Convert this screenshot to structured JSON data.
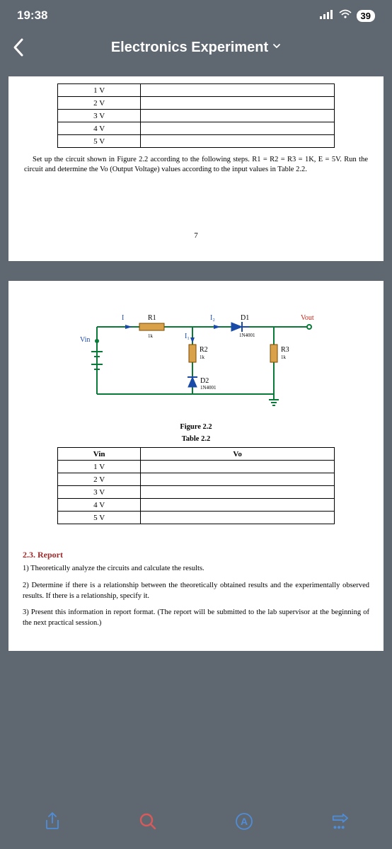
{
  "status": {
    "time": "19:38",
    "battery": "39"
  },
  "header": {
    "title": "Electronics Experiment"
  },
  "page1": {
    "table1_rows": [
      "1 V",
      "2 V",
      "3 V",
      "4 V",
      "5 V"
    ],
    "instruction": "Set up the circuit shown in Figure 2.2 according to the following steps. R1 = R2 = R3 = 1K, E = 5V. Run the circuit and determine the Vo (Output Voltage) values according to the input values in Table 2.2.",
    "page_num": "7"
  },
  "circuit": {
    "vin": "Vin",
    "vout": "Vout",
    "r1": "R1",
    "r1v": "1k",
    "r2": "R2",
    "r2v": "1k",
    "r3": "R3",
    "r3v": "1k",
    "d1": "D1",
    "d1v": "1N4001",
    "d2": "D2",
    "d2v": "1N4001",
    "i": "I",
    "i1": "I₁",
    "i2": "I₂"
  },
  "fig_caption": "Figure 2.2",
  "tbl_caption": "Table 2.2",
  "table22": {
    "head_vin": "Vin",
    "head_vo": "Vo",
    "rows": [
      "1 V",
      "2 V",
      "3 V",
      "4 V",
      "5 V"
    ]
  },
  "report": {
    "heading": "2.3. Report",
    "item1": "1) Theoretically analyze the circuits and calculate the results.",
    "item2": "2) Determine if there is a relationship between the theoretically obtained results and the experimentally observed results. If there is a relationship, specify it.",
    "item3": "3) Present this information in report format. (The report will be submitted to the lab supervisor at the beginning of the next practical session.)"
  }
}
